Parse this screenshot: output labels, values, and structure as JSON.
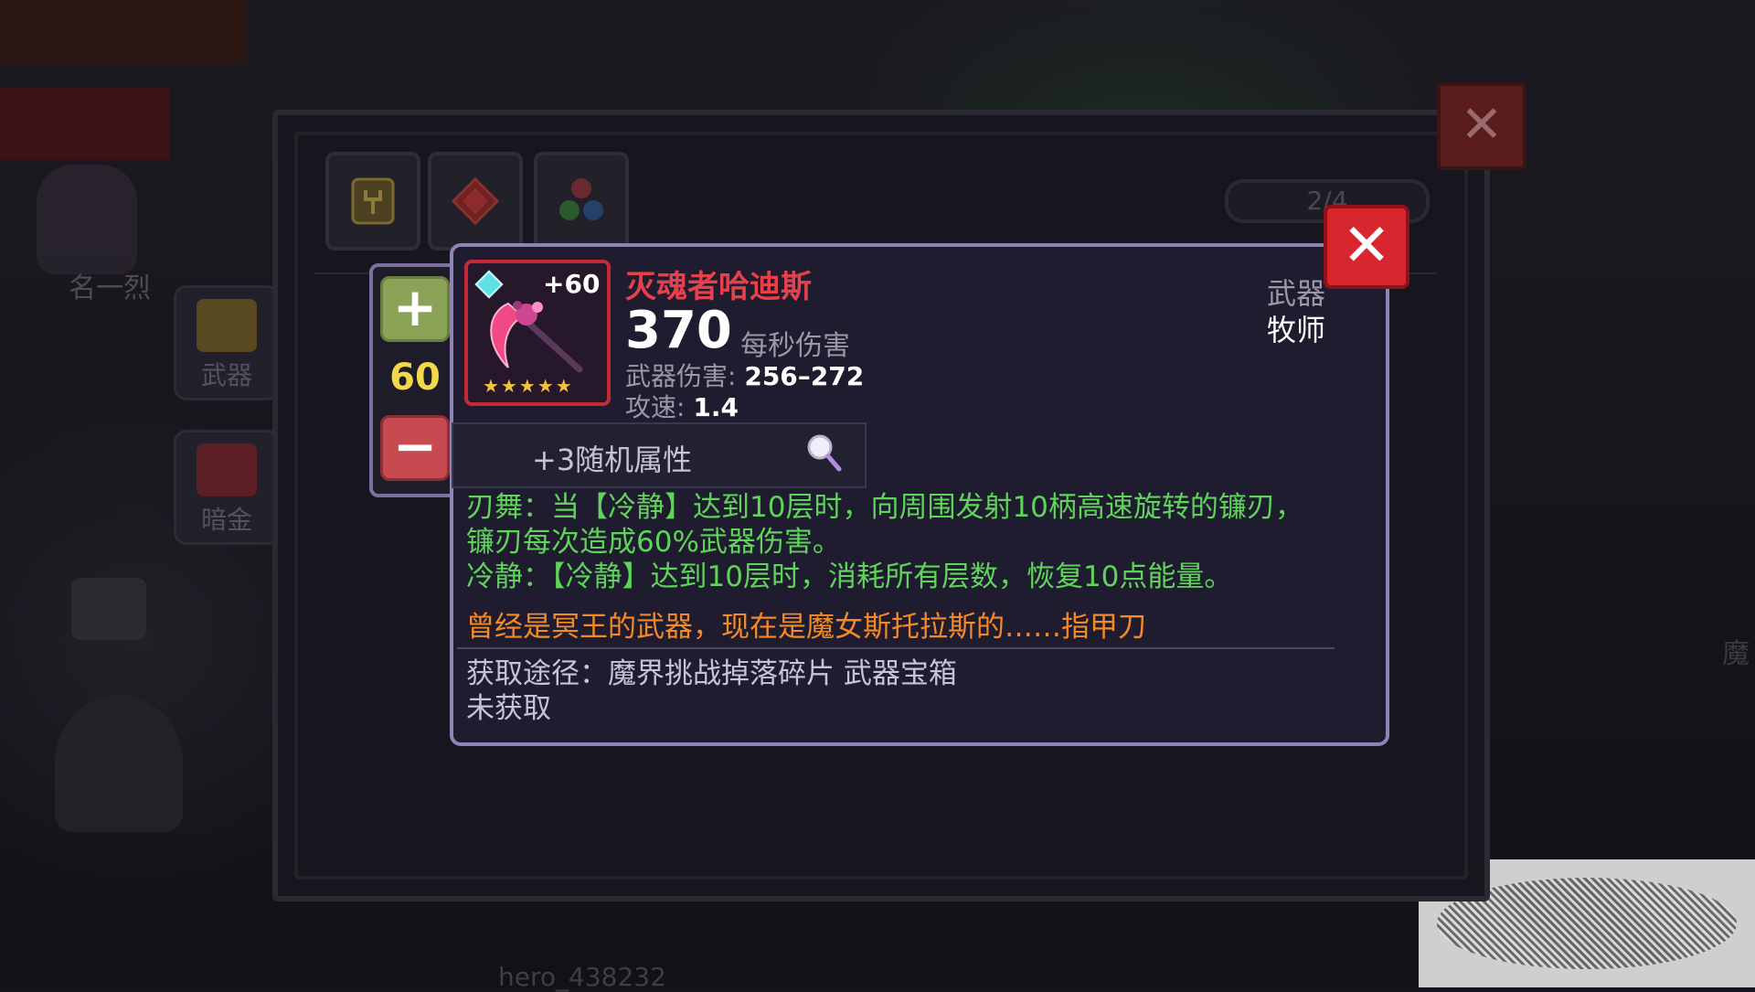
{
  "background": {
    "side_tabs": [
      {
        "label": "武器"
      },
      {
        "label": "暗金"
      }
    ],
    "player_name_fragment": "名一烈",
    "hero_name": "hero_438232",
    "right_edge_text": "魔"
  },
  "outer_dialog": {
    "page_indicator": "2/4",
    "close_label": "✕"
  },
  "stepper": {
    "plus_label": "+",
    "value": "60",
    "minus_label": "−"
  },
  "item": {
    "enhance": "+60",
    "star_count": 5,
    "stars": "★★★★★",
    "name": "灭魂者哈迪斯",
    "dps": "370",
    "dps_label": "每秒伤害",
    "damage_label": "武器伤害: ",
    "damage_value": "256–272",
    "speed_label": "攻速: ",
    "speed_value": "1.4",
    "type": "武器",
    "class": "牧师",
    "random_attr": "+3随机属性",
    "desc_line1": "刃舞：当【冷静】达到10层时，向周围发射10柄高速旋转的镰刃，镰刃每次造成60%武器伤害。",
    "desc_line2": "冷静：【冷静】达到10层时，消耗所有层数，恢复10点能量。",
    "lore": "曾经是冥王的武器，现在是魔女斯托拉斯的……指甲刀",
    "source": "获取途径：魔界挑战掉落碎片 武器宝箱",
    "status": "未获取",
    "close_label": "✕"
  },
  "colors": {
    "name_red": "#e8404b",
    "skill_green": "#5fd35a",
    "lore_orange": "#f28a2a",
    "level_yellow": "#f3d94a"
  }
}
